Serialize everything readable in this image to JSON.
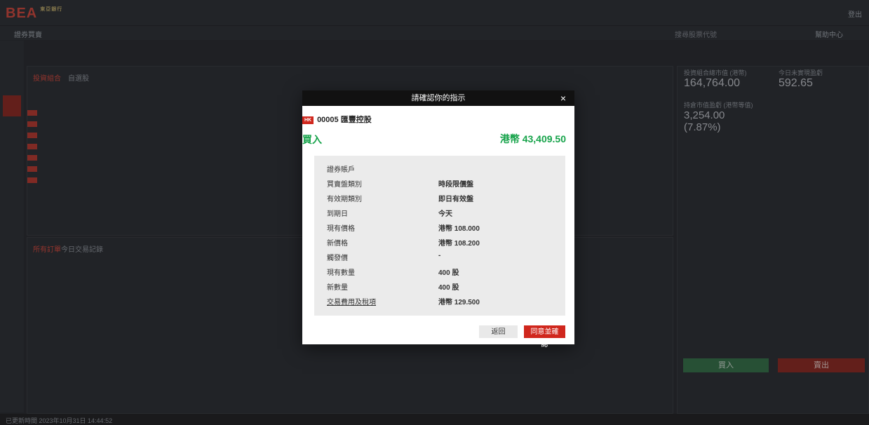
{
  "app": {
    "logo_text": "BEA",
    "logo_sub": "東亞銀行",
    "logout_label": "登出",
    "search_placeholder": "搜尋股票代號",
    "help_label": "幫助中心",
    "section_title": "證券買賣"
  },
  "background": {
    "left_tabs": [
      "投資組合",
      "自選股"
    ],
    "bottom_tabs": [
      "所有訂單",
      "今日交易記錄"
    ],
    "right_panel": {
      "label1": "投資組合總市值 (港幣)",
      "value1": "164,764.00",
      "label2": "今日未實現盈虧",
      "value2": "592.65",
      "label3": "持倉市值盈虧 (港幣等值)",
      "value3": "3,254.00 (7.87%)",
      "buy_label": "買入",
      "sell_label": "賣出"
    },
    "status_text": "已更新時間 2023年10月31日 14:44:52"
  },
  "modal": {
    "title": "請確認你的指示",
    "close": "×",
    "stock_tag": "HK",
    "stock": "00005 匯豐控股",
    "order_type": "買入",
    "amount": "港幣 43,409.50",
    "rows": [
      {
        "label": "證券賬戶",
        "value": ""
      },
      {
        "label": "買賣盤類別",
        "value": "時段限價盤"
      },
      {
        "label": "有效期類別",
        "value": "即日有效盤"
      },
      {
        "label": "到期日",
        "value": "今天"
      },
      {
        "label": "現有價格",
        "value": "港幣 108.000"
      },
      {
        "label": "新價格",
        "value": "港幣 108.200"
      },
      {
        "label": "觸發價",
        "value": "-"
      },
      {
        "label": "現有數量",
        "value": "400 股"
      },
      {
        "label": "新數量",
        "value": "400 股"
      },
      {
        "label": "交易費用及稅項",
        "value": "港幣 129.500"
      }
    ],
    "return_label": "返回",
    "confirm_label": "同意並確認"
  }
}
